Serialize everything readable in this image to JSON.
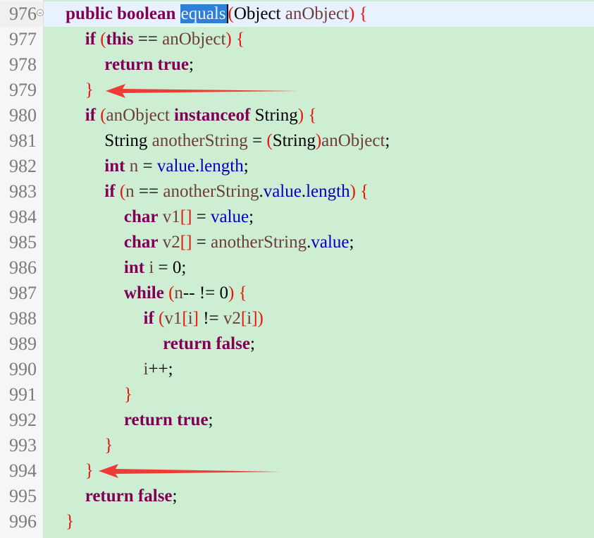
{
  "colors": {
    "kw": "#7f0055",
    "id": "#6a3e3e",
    "field": "#0000c0",
    "type": "#000000",
    "paren": "#e8150d",
    "plain": "#000000",
    "sel": "#e9f2ff",
    "sel_bg": "#2f7ed8",
    "arrow": "#ef3b36"
  },
  "editor": {
    "lines": [
      {
        "number": "976",
        "level": 1,
        "tokens": [
          {
            "t": "public",
            "k": "kw"
          },
          {
            "t": " ",
            "k": "plain"
          },
          {
            "t": "boolean",
            "k": "kw"
          },
          {
            "t": " ",
            "k": "plain"
          },
          {
            "t": "equals",
            "k": "sel"
          },
          {
            "t": "(",
            "k": "paren"
          },
          {
            "t": "Object",
            "k": "type"
          },
          {
            "t": " ",
            "k": "plain"
          },
          {
            "t": "anObject",
            "k": "id"
          },
          {
            "t": ")",
            "k": "paren"
          },
          {
            "t": " ",
            "k": "plain"
          },
          {
            "t": "{",
            "k": "paren"
          }
        ]
      },
      {
        "number": "977",
        "level": 2,
        "tokens": [
          {
            "t": "if",
            "k": "kw"
          },
          {
            "t": " ",
            "k": "plain"
          },
          {
            "t": "(",
            "k": "paren"
          },
          {
            "t": "this",
            "k": "kw"
          },
          {
            "t": " == ",
            "k": "plain"
          },
          {
            "t": "anObject",
            "k": "id"
          },
          {
            "t": ")",
            "k": "paren"
          },
          {
            "t": " ",
            "k": "plain"
          },
          {
            "t": "{",
            "k": "paren"
          }
        ]
      },
      {
        "number": "978",
        "level": 3,
        "tokens": [
          {
            "t": "return",
            "k": "kw"
          },
          {
            "t": " ",
            "k": "plain"
          },
          {
            "t": "true",
            "k": "kw"
          },
          {
            "t": ";",
            "k": "plain"
          }
        ]
      },
      {
        "number": "979",
        "level": 2,
        "tokens": [
          {
            "t": "}",
            "k": "paren"
          }
        ]
      },
      {
        "number": "980",
        "level": 2,
        "tokens": [
          {
            "t": "if",
            "k": "kw"
          },
          {
            "t": " ",
            "k": "plain"
          },
          {
            "t": "(",
            "k": "paren"
          },
          {
            "t": "anObject",
            "k": "id"
          },
          {
            "t": " ",
            "k": "plain"
          },
          {
            "t": "instanceof",
            "k": "kw"
          },
          {
            "t": " ",
            "k": "plain"
          },
          {
            "t": "String",
            "k": "type"
          },
          {
            "t": ")",
            "k": "paren"
          },
          {
            "t": " ",
            "k": "plain"
          },
          {
            "t": "{",
            "k": "paren"
          }
        ]
      },
      {
        "number": "981",
        "level": 3,
        "tokens": [
          {
            "t": "String",
            "k": "type"
          },
          {
            "t": " ",
            "k": "plain"
          },
          {
            "t": "anotherString",
            "k": "id"
          },
          {
            "t": " = ",
            "k": "plain"
          },
          {
            "t": "(",
            "k": "paren"
          },
          {
            "t": "String",
            "k": "type"
          },
          {
            "t": ")",
            "k": "paren"
          },
          {
            "t": "anObject",
            "k": "id"
          },
          {
            "t": ";",
            "k": "plain"
          }
        ]
      },
      {
        "number": "982",
        "level": 3,
        "tokens": [
          {
            "t": "int",
            "k": "kw"
          },
          {
            "t": " ",
            "k": "plain"
          },
          {
            "t": "n",
            "k": "id"
          },
          {
            "t": " = ",
            "k": "plain"
          },
          {
            "t": "value",
            "k": "field"
          },
          {
            "t": ".",
            "k": "plain"
          },
          {
            "t": "length",
            "k": "field"
          },
          {
            "t": ";",
            "k": "plain"
          }
        ]
      },
      {
        "number": "983",
        "level": 3,
        "tokens": [
          {
            "t": "if",
            "k": "kw"
          },
          {
            "t": " ",
            "k": "plain"
          },
          {
            "t": "(",
            "k": "paren"
          },
          {
            "t": "n",
            "k": "id"
          },
          {
            "t": " == ",
            "k": "plain"
          },
          {
            "t": "anotherString",
            "k": "id"
          },
          {
            "t": ".",
            "k": "plain"
          },
          {
            "t": "value",
            "k": "field"
          },
          {
            "t": ".",
            "k": "plain"
          },
          {
            "t": "length",
            "k": "field"
          },
          {
            "t": ")",
            "k": "paren"
          },
          {
            "t": " ",
            "k": "plain"
          },
          {
            "t": "{",
            "k": "paren"
          }
        ]
      },
      {
        "number": "984",
        "level": 4,
        "tokens": [
          {
            "t": "char",
            "k": "kw"
          },
          {
            "t": " ",
            "k": "plain"
          },
          {
            "t": "v1",
            "k": "id"
          },
          {
            "t": "[]",
            "k": "paren"
          },
          {
            "t": " = ",
            "k": "plain"
          },
          {
            "t": "value",
            "k": "field"
          },
          {
            "t": ";",
            "k": "plain"
          }
        ]
      },
      {
        "number": "985",
        "level": 4,
        "tokens": [
          {
            "t": "char",
            "k": "kw"
          },
          {
            "t": " ",
            "k": "plain"
          },
          {
            "t": "v2",
            "k": "id"
          },
          {
            "t": "[]",
            "k": "paren"
          },
          {
            "t": " = ",
            "k": "plain"
          },
          {
            "t": "anotherString",
            "k": "id"
          },
          {
            "t": ".",
            "k": "plain"
          },
          {
            "t": "value",
            "k": "field"
          },
          {
            "t": ";",
            "k": "plain"
          }
        ]
      },
      {
        "number": "986",
        "level": 4,
        "tokens": [
          {
            "t": "int",
            "k": "kw"
          },
          {
            "t": " ",
            "k": "plain"
          },
          {
            "t": "i",
            "k": "id"
          },
          {
            "t": " = 0;",
            "k": "plain"
          }
        ]
      },
      {
        "number": "987",
        "level": 4,
        "tokens": [
          {
            "t": "while",
            "k": "kw"
          },
          {
            "t": " ",
            "k": "plain"
          },
          {
            "t": "(",
            "k": "paren"
          },
          {
            "t": "n",
            "k": "id"
          },
          {
            "t": "-- != 0",
            "k": "plain"
          },
          {
            "t": ")",
            "k": "paren"
          },
          {
            "t": " ",
            "k": "plain"
          },
          {
            "t": "{",
            "k": "paren"
          }
        ]
      },
      {
        "number": "988",
        "level": 5,
        "tokens": [
          {
            "t": "if",
            "k": "kw"
          },
          {
            "t": " ",
            "k": "plain"
          },
          {
            "t": "(",
            "k": "paren"
          },
          {
            "t": "v1",
            "k": "id"
          },
          {
            "t": "[",
            "k": "paren"
          },
          {
            "t": "i",
            "k": "id"
          },
          {
            "t": "]",
            "k": "paren"
          },
          {
            "t": " != ",
            "k": "plain"
          },
          {
            "t": "v2",
            "k": "id"
          },
          {
            "t": "[",
            "k": "paren"
          },
          {
            "t": "i",
            "k": "id"
          },
          {
            "t": "]",
            "k": "paren"
          },
          {
            "t": ")",
            "k": "paren"
          }
        ]
      },
      {
        "number": "989",
        "level": 6,
        "tokens": [
          {
            "t": "return",
            "k": "kw"
          },
          {
            "t": " ",
            "k": "plain"
          },
          {
            "t": "false",
            "k": "kw"
          },
          {
            "t": ";",
            "k": "plain"
          }
        ]
      },
      {
        "number": "990",
        "level": 5,
        "tokens": [
          {
            "t": "i",
            "k": "id"
          },
          {
            "t": "++;",
            "k": "plain"
          }
        ]
      },
      {
        "number": "991",
        "level": 4,
        "tokens": [
          {
            "t": "}",
            "k": "paren"
          }
        ]
      },
      {
        "number": "992",
        "level": 4,
        "tokens": [
          {
            "t": "return",
            "k": "kw"
          },
          {
            "t": " ",
            "k": "plain"
          },
          {
            "t": "true",
            "k": "kw"
          },
          {
            "t": ";",
            "k": "plain"
          }
        ]
      },
      {
        "number": "993",
        "level": 3,
        "tokens": [
          {
            "t": "}",
            "k": "paren"
          }
        ]
      },
      {
        "number": "994",
        "level": 2,
        "tokens": [
          {
            "t": "}",
            "k": "paren"
          }
        ]
      },
      {
        "number": "995",
        "level": 2,
        "tokens": [
          {
            "t": "return",
            "k": "kw"
          },
          {
            "t": " ",
            "k": "plain"
          },
          {
            "t": "false",
            "k": "kw"
          },
          {
            "t": ";",
            "k": "plain"
          }
        ]
      },
      {
        "number": "996",
        "level": 1,
        "tokens": [
          {
            "t": "}",
            "k": "paren"
          }
        ]
      }
    ],
    "current_line": "976",
    "folded_marker_icon": "fold-collapse-icon",
    "annotation_arrows_at_lines": [
      "979",
      "994"
    ]
  }
}
